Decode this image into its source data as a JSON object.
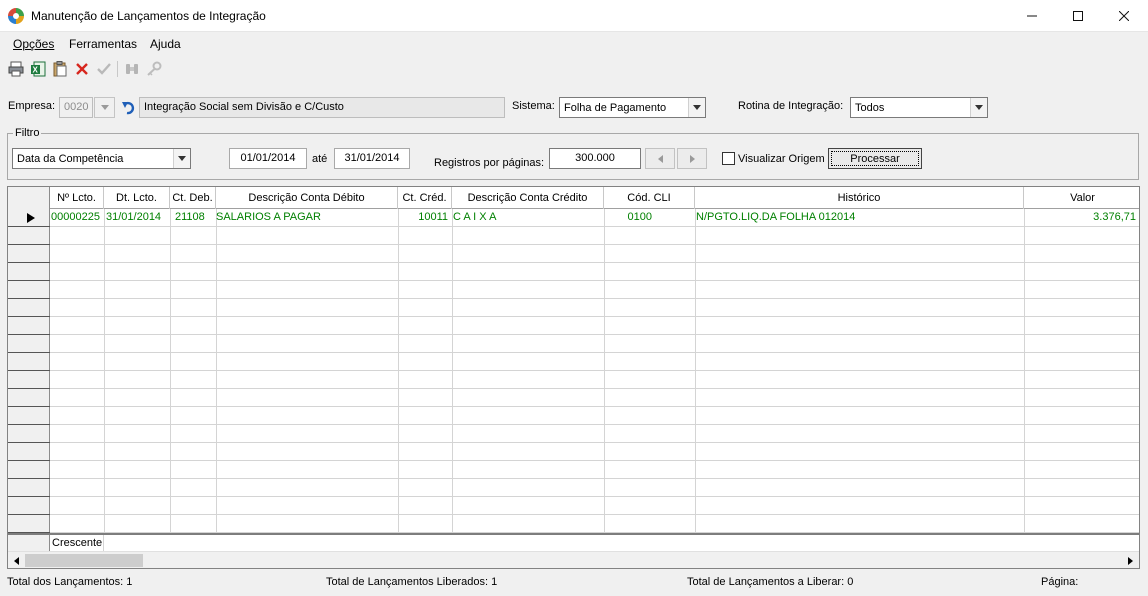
{
  "window": {
    "title": "Manutenção de Lançamentos de Integração",
    "minimize": "–",
    "maximize": "☐",
    "close": "✕"
  },
  "menu": {
    "items": [
      {
        "label": "Opções"
      },
      {
        "label": "Ferramentas"
      },
      {
        "label": "Ajuda"
      }
    ]
  },
  "toolbar": {
    "icons": [
      "print-icon",
      "excel-export-icon",
      "paste-icon",
      "delete-icon",
      "confirm-icon",
      "binoculars-icon",
      "key-icon"
    ]
  },
  "empresa": {
    "label": "Empresa:",
    "code": "0020",
    "name": "Integração Social sem Divisão e C/Custo"
  },
  "sistema": {
    "label": "Sistema:",
    "value": "Folha de Pagamento"
  },
  "rotina": {
    "label": "Rotina de Integração:",
    "value": "Todos"
  },
  "filtro": {
    "title": "Filtro",
    "date_type": "Data da Competência",
    "date_from": "01/01/2014",
    "until_label": "até",
    "date_to": "31/01/2014",
    "records_label": "Registros por páginas:",
    "records_value": "300.000",
    "show_origin_label": "Visualizar Origem",
    "show_origin_checked": false,
    "process_button": "Processar"
  },
  "grid": {
    "columns": [
      "Nº Lcto.",
      "Dt. Lcto.",
      "Ct. Deb.",
      "Descrição Conta Débito",
      "Ct. Créd.",
      "Descrição Conta Crédito",
      "Cód. CLI",
      "Histórico",
      "Valor"
    ],
    "rows": [
      {
        "numero": "00000225",
        "data": "31/01/2014",
        "ct_deb": "21108",
        "desc_deb": "SALARIOS A PAGAR",
        "ct_cred": "10011",
        "desc_cred": "C A I X A",
        "cod_cli": "0100",
        "historico": "N/PGTO.LIQ.DA FOLHA 012014",
        "valor": "3.376,71"
      }
    ],
    "footer": "Crescente",
    "row_text_color": "#008000"
  },
  "status": {
    "total_lancamentos": "Total dos Lançamentos: 1",
    "total_liberados": "Total de Lançamentos Liberados: 1",
    "total_a_liberar": "Total de Lançamentos a Liberar: 0",
    "pagina": "Página:"
  }
}
